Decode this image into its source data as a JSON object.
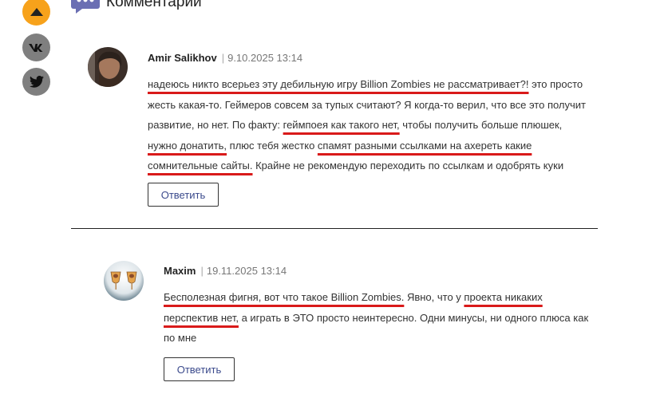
{
  "header": {
    "title": "Комментарии",
    "icon": "chat-icon"
  },
  "side_buttons": [
    {
      "name": "scroll-up-button",
      "icon": "arrow-up-icon",
      "color": "#f7a21b"
    },
    {
      "name": "vk-share-button",
      "icon": "vk-icon",
      "color": "#7f7f7f"
    },
    {
      "name": "twitter-share-button",
      "icon": "twitter-icon",
      "color": "#7f7f7f"
    }
  ],
  "comments": [
    {
      "author": "Amir Salikhov",
      "separator": "|",
      "date": "9.10.2025 13:14",
      "text_parts": [
        "надеюсь никто всерьез эту дебильную игру Billion Zombies не рассматривает?!",
        " это просто жесть какая-то. Геймеров совсем за тупых считают? Я когда-то верил, что все это получит развитие, но нет. По факту: ",
        "геймпоея как такого нет,",
        " чтобы получить больше плюшек, ",
        "нужно донатить,",
        " плюс тебя жестко ",
        "спамят разными ссылками на ахереть какие сомнительные сайты.",
        " Крайне не рекомендую переходить по ссылкам и одобрять куки"
      ],
      "reply_label": "Ответить"
    },
    {
      "author": "Maxim",
      "separator": "|",
      "date": "19.11.2025 13:14",
      "text_parts": [
        "Бесполезная фигня, вот что такое Billion Zombies.",
        " Явно, что у ",
        "проекта никаких перспектив нет,",
        " а играть в ЭТО просто неинтересно. Одни минусы, ни одного плюса как по мне"
      ],
      "reply_label": "Ответить"
    }
  ],
  "colors": {
    "accent": "#f7a21b",
    "underline": "#d91a1a",
    "button_text": "#3b4a8c",
    "chat_icon": "#6b6fb3"
  }
}
